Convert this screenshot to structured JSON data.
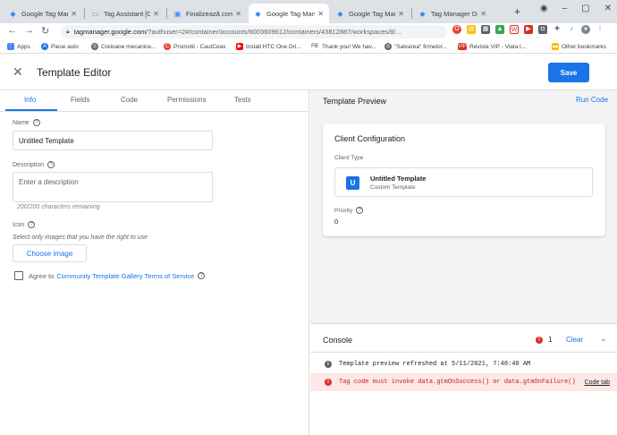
{
  "browser": {
    "tabs": [
      {
        "label": "Google Tag Mana",
        "icon": "gtm-icon"
      },
      {
        "label": "Tag Assistant [Co",
        "icon": "tag-assistant-icon"
      },
      {
        "label": "Finalizează coman",
        "icon": "page-icon"
      },
      {
        "label": "Google Tag Mana",
        "icon": "gtm-icon"
      },
      {
        "label": "Google Tag Mana",
        "icon": "gtm-icon"
      },
      {
        "label": "Tag Manager Deb",
        "icon": "gtm-icon"
      }
    ],
    "url_host": "tagmanager.google.com",
    "url_path": "/?authuser=2#/container/accounts/6003609612/containers/43812887/workspaces/8/...",
    "bookmarks": [
      {
        "label": "Apps",
        "color": "#4285f4"
      },
      {
        "label": "Piese auto",
        "color": "#1a73e8"
      },
      {
        "label": "Creioane mecanice...",
        "color": "#5f6368"
      },
      {
        "label": "Promotii - CautCeas",
        "color": "#ea4335"
      },
      {
        "label": "Install HTC One Dri...",
        "color": "#ff0000"
      },
      {
        "label": "Thank you! We hav...",
        "color": "#3b5998"
      },
      {
        "label": "\"Salvarea\" firmelor...",
        "color": "#5f6368"
      },
      {
        "label": "Revista VIP - Viata l...",
        "color": "#d93025"
      },
      {
        "label": "Other bookmarks",
        "color": "#fbbc04"
      }
    ]
  },
  "header": {
    "title": "Template Editor",
    "save_label": "Save"
  },
  "editor_tabs": [
    "Info",
    "Fields",
    "Code",
    "Permissions",
    "Tests"
  ],
  "info": {
    "name_label": "Name",
    "name_value": "Untitled Template",
    "description_label": "Description",
    "description_placeholder": "Enter a description",
    "chars_remaining": "200/200 characters remaining",
    "icon_label": "Icon",
    "icon_hint": "Select only images that you have the right to use",
    "choose_image_label": "Choose image",
    "agree_prefix": "Agree to",
    "agree_link": "Community Template Gallery Terms of Service"
  },
  "preview": {
    "title": "Template Preview",
    "run_code": "Run Code",
    "config_title": "Client Configuration",
    "client_type_label": "Client Type",
    "client_avatar": "U",
    "client_name": "Untitled Template",
    "client_sub": "Custom Template",
    "priority_label": "Priority",
    "priority_value": "0"
  },
  "console": {
    "title": "Console",
    "error_count": "1",
    "clear_label": "Clear",
    "logs": [
      {
        "type": "info",
        "message": "Template preview refreshed at 5/11/2021, 7:48:40 AM"
      },
      {
        "type": "error",
        "message": "Tag code must invoke data.gtmOnSuccess() or data.gtmOnFailure()",
        "link_label": "Code tab"
      }
    ]
  },
  "colors": {
    "accent": "#1a73e8",
    "error": "#d93025",
    "error_bg": "#fce8e6"
  }
}
